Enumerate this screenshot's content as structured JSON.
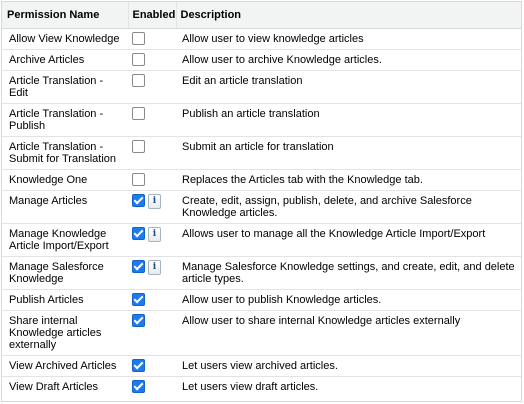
{
  "table": {
    "headers": {
      "permission_name": "Permission Name",
      "enabled": "Enabled",
      "description": "Description"
    },
    "rows": [
      {
        "name": "Allow View Knowledge",
        "enabled": false,
        "info": false,
        "description": "Allow user to view knowledge articles"
      },
      {
        "name": "Archive Articles",
        "enabled": false,
        "info": false,
        "description": "Allow user to archive Knowledge articles."
      },
      {
        "name": "Article Translation - Edit",
        "enabled": false,
        "info": false,
        "description": "Edit an article translation"
      },
      {
        "name": "Article Translation - Publish",
        "enabled": false,
        "info": false,
        "description": "Publish an article translation"
      },
      {
        "name": "Article Translation - Submit for Translation",
        "enabled": false,
        "info": false,
        "description": "Submit an article for translation"
      },
      {
        "name": "Knowledge One",
        "enabled": false,
        "info": false,
        "description": "Replaces the Articles tab with the Knowledge tab."
      },
      {
        "name": "Manage Articles",
        "enabled": true,
        "info": true,
        "description": "Create, edit, assign, publish, delete, and archive Salesforce Knowledge articles."
      },
      {
        "name": "Manage Knowledge Article Import/Export",
        "enabled": true,
        "info": true,
        "description": "Allows user to manage all the Knowledge Article Import/Export"
      },
      {
        "name": "Manage Salesforce Knowledge",
        "enabled": true,
        "info": true,
        "description": "Manage Salesforce Knowledge settings, and create, edit, and delete article types."
      },
      {
        "name": "Publish Articles",
        "enabled": true,
        "info": false,
        "description": "Allow user to publish Knowledge articles."
      },
      {
        "name": "Share internal Knowledge articles externally",
        "enabled": true,
        "info": false,
        "description": "Allow user to share internal Knowledge articles externally"
      },
      {
        "name": "View Archived Articles",
        "enabled": true,
        "info": false,
        "description": "Let users view archived articles."
      },
      {
        "name": "View Draft Articles",
        "enabled": true,
        "info": false,
        "description": "Let users view draft articles."
      }
    ],
    "info_glyph": "i",
    "icons": {
      "checkbox": "checkbox-icon",
      "info": "info-icon"
    }
  }
}
